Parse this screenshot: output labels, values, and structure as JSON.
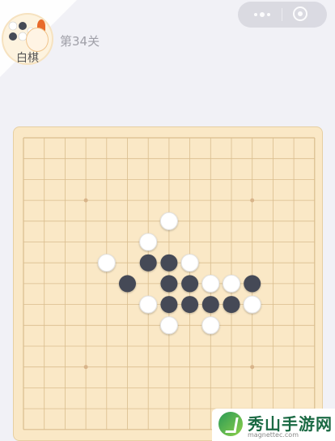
{
  "player": {
    "label": "白棋"
  },
  "level": {
    "label": "第34关"
  },
  "watermark": {
    "title": "秀山手游网",
    "url": "magnettec.com"
  },
  "board": {
    "size": 15,
    "star_points": [
      [
        3,
        3
      ],
      [
        11,
        3
      ],
      [
        3,
        11
      ],
      [
        11,
        11
      ]
    ],
    "black_stones": [
      [
        6,
        6
      ],
      [
        7,
        6
      ],
      [
        5,
        7
      ],
      [
        7,
        7
      ],
      [
        8,
        7
      ],
      [
        11,
        7
      ],
      [
        7,
        8
      ],
      [
        8,
        8
      ],
      [
        9,
        8
      ],
      [
        10,
        8
      ]
    ],
    "white_stones": [
      [
        7,
        4
      ],
      [
        6,
        5
      ],
      [
        4,
        6
      ],
      [
        8,
        6
      ],
      [
        9,
        7
      ],
      [
        10,
        7
      ],
      [
        6,
        8
      ],
      [
        11,
        8
      ],
      [
        7,
        9
      ],
      [
        9,
        9
      ]
    ],
    "colors": {
      "background": "#fae8c6",
      "line": "#d9bd8e",
      "black": "#454a56",
      "white": "#ffffff"
    }
  }
}
